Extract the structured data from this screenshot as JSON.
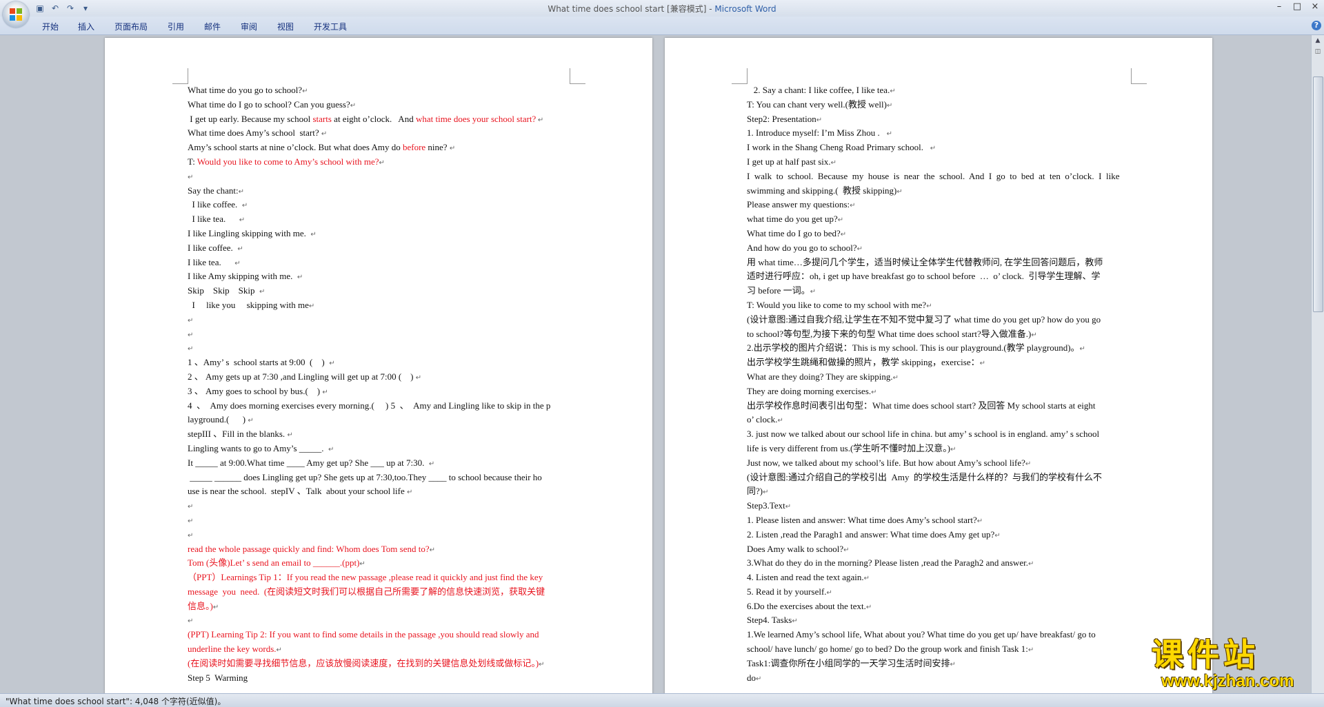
{
  "window": {
    "title_doc": "What time does school start [兼容模式] - ",
    "title_app": "Microsoft Word",
    "controls": [
      "–",
      "□",
      "×"
    ]
  },
  "qat": [
    "save-icon",
    "undo-icon",
    "redo-icon",
    "customize-icon"
  ],
  "ribbon": {
    "tabs": [
      "开始",
      "插入",
      "页面布局",
      "引用",
      "邮件",
      "审阅",
      "视图",
      "开发工具"
    ],
    "help": "?"
  },
  "left_page": {
    "lines": [
      {
        "parts": [
          {
            "t": "What time do you go to school?"
          },
          {
            "t": "↵",
            "pm": 1
          }
        ]
      },
      {
        "parts": [
          {
            "t": "What time do I go to school? Can you guess?"
          },
          {
            "t": "↵",
            "pm": 1
          }
        ]
      },
      {
        "parts": [
          {
            "t": " I get up early. Because my school "
          },
          {
            "t": "starts",
            "r": 1
          },
          {
            "t": " at eight o’clock.   And "
          },
          {
            "t": "what time does your school start?",
            "r": 1
          },
          {
            "t": " ↵",
            "pm": 1
          }
        ]
      },
      {
        "parts": [
          {
            "t": "What time does Amy’s school  start? "
          },
          {
            "t": "↵",
            "pm": 1
          }
        ]
      },
      {
        "parts": [
          {
            "t": "Amy’s school starts at nine o’clock. But what does Amy do "
          },
          {
            "t": "before",
            "r": 1
          },
          {
            "t": " nine? "
          },
          {
            "t": "↵",
            "pm": 1
          }
        ]
      },
      {
        "parts": [
          {
            "t": "T: "
          },
          {
            "t": "Would you like to come to Amy’s school with me?",
            "r": 1
          },
          {
            "t": "↵",
            "pm": 1
          }
        ]
      },
      {
        "parts": [
          {
            "t": "↵",
            "pm": 1
          }
        ]
      },
      {
        "parts": [
          {
            "t": "Say the chant:"
          },
          {
            "t": "↵",
            "pm": 1
          }
        ]
      },
      {
        "parts": [
          {
            "t": "  I like coffee.  "
          },
          {
            "t": "↵",
            "pm": 1
          }
        ]
      },
      {
        "parts": [
          {
            "t": "  I like tea.      "
          },
          {
            "t": "↵",
            "pm": 1
          }
        ]
      },
      {
        "parts": [
          {
            "t": "I like Lingling skipping with me.  "
          },
          {
            "t": "↵",
            "pm": 1
          }
        ]
      },
      {
        "parts": [
          {
            "t": "I like coffee.  "
          },
          {
            "t": "↵",
            "pm": 1
          }
        ]
      },
      {
        "parts": [
          {
            "t": "I like tea.      "
          },
          {
            "t": "↵",
            "pm": 1
          }
        ]
      },
      {
        "parts": [
          {
            "t": "I like Amy skipping with me.  "
          },
          {
            "t": "↵",
            "pm": 1
          }
        ]
      },
      {
        "parts": [
          {
            "t": "Skip    Skip    Skip  "
          },
          {
            "t": "↵",
            "pm": 1
          }
        ]
      },
      {
        "parts": [
          {
            "t": "  I     like you     skipping with me"
          },
          {
            "t": "↵",
            "pm": 1
          }
        ]
      },
      {
        "parts": [
          {
            "t": "↵",
            "pm": 1
          }
        ]
      },
      {
        "parts": [
          {
            "t": "↵",
            "pm": 1
          }
        ]
      },
      {
        "parts": [
          {
            "t": "↵",
            "pm": 1
          }
        ]
      },
      {
        "parts": [
          {
            "t": "1 、Amy’ s  school starts at 9:00  (    )  "
          },
          {
            "t": "↵",
            "pm": 1
          }
        ]
      },
      {
        "parts": [
          {
            "t": "2 、 Amy gets up at 7:30 ,and Lingling will get up at 7:00 (    ) "
          },
          {
            "t": "↵",
            "pm": 1
          }
        ]
      },
      {
        "parts": [
          {
            "t": "3 、 Amy goes to school by bus.(    ) "
          },
          {
            "t": "↵",
            "pm": 1
          }
        ]
      },
      {
        "parts": [
          {
            "t": "4  、  Amy does morning exercises every morning.(     ) 5  、  Amy and Lingling like to skip in the p"
          }
        ]
      },
      {
        "parts": [
          {
            "t": "layground.(      ) "
          },
          {
            "t": "↵",
            "pm": 1
          }
        ]
      },
      {
        "parts": [
          {
            "t": "stepIII 、Fill in the blanks. "
          },
          {
            "t": "↵",
            "pm": 1
          }
        ]
      },
      {
        "parts": [
          {
            "t": "Lingling wants to go to Amy’s _____.  "
          },
          {
            "t": "↵",
            "pm": 1
          }
        ]
      },
      {
        "parts": [
          {
            "t": "It _____ at 9:00.What time ____ Amy get up? She ___ up at 7:30.  "
          },
          {
            "t": "↵",
            "pm": 1
          }
        ]
      },
      {
        "parts": [
          {
            "t": " _____ ______ does Lingling get up? She gets up at 7:30,too.They ____ to school because their ho"
          }
        ]
      },
      {
        "parts": [
          {
            "t": "use is near the school.  stepIV 、Talk  about your school life "
          },
          {
            "t": "↵",
            "pm": 1
          }
        ]
      },
      {
        "parts": [
          {
            "t": "↵",
            "pm": 1
          }
        ]
      },
      {
        "parts": [
          {
            "t": "↵",
            "pm": 1
          }
        ]
      },
      {
        "parts": [
          {
            "t": "↵",
            "pm": 1
          }
        ]
      },
      {
        "parts": [
          {
            "t": "read the whole passage quickly and find: Whom does Tom send to?",
            "r": 1
          },
          {
            "t": "↵",
            "pm": 1
          }
        ]
      },
      {
        "parts": [
          {
            "t": "Tom (头像)Let’ s send an email to ______.(ppt)",
            "r": 1
          },
          {
            "t": "↵",
            "pm": 1
          }
        ]
      },
      {
        "parts": [
          {
            "t": "（PPT）Learnings Tip 1：If you read the new passage ,please read it quickly and just find the key",
            "r": 1
          }
        ]
      },
      {
        "parts": [
          {
            "t": "message  you  need.  (在阅读短文时我们可以根据自己所需要了解的信息快速浏览，获取关键",
            "r": 1
          }
        ]
      },
      {
        "parts": [
          {
            "t": "信息。)",
            "r": 1
          },
          {
            "t": "↵",
            "pm": 1
          }
        ]
      },
      {
        "parts": [
          {
            "t": "↵",
            "pm": 1
          }
        ]
      },
      {
        "parts": [
          {
            "t": "(PPT) Learning Tip 2: If you want to find some details in the passage ,you should read slowly and",
            "r": 1
          }
        ]
      },
      {
        "parts": [
          {
            "t": "underline the key words.",
            "r": 1
          },
          {
            "t": "↵",
            "pm": 1
          }
        ]
      },
      {
        "parts": [
          {
            "t": "(在阅读时如需要寻找细节信息，应该放慢阅读速度，在找到的关键信息处划线或做标记。)",
            "r": 1
          },
          {
            "t": "↵",
            "pm": 1
          }
        ]
      },
      {
        "parts": [
          {
            "t": "Step 5  Warming"
          }
        ]
      }
    ]
  },
  "right_page": {
    "lines": [
      {
        "parts": [
          {
            "t": "   2. Say a chant: I like coffee, I like tea."
          },
          {
            "t": "↵",
            "pm": 1
          }
        ]
      },
      {
        "parts": [
          {
            "t": "T: You can chant very well.(教授 well)"
          },
          {
            "t": "↵",
            "pm": 1
          }
        ]
      },
      {
        "parts": [
          {
            "t": "Step2: Presentation"
          },
          {
            "t": "↵",
            "pm": 1
          }
        ]
      },
      {
        "parts": [
          {
            "t": "1. Introduce myself: I’m Miss Zhou .   "
          },
          {
            "t": "↵",
            "pm": 1
          }
        ]
      },
      {
        "parts": [
          {
            "t": "I work in the Shang Cheng Road Primary school.   "
          },
          {
            "t": "↵",
            "pm": 1
          }
        ]
      },
      {
        "parts": [
          {
            "t": "I get up at half past six."
          },
          {
            "t": "↵",
            "pm": 1
          }
        ]
      },
      {
        "parts": [
          {
            "t": "I  walk  to  school.  Because  my  house  is  near  the  school.  And  I  go  to  bed  at  ten  o’clock.  I  like"
          }
        ]
      },
      {
        "parts": [
          {
            "t": "swimming and skipping.(  教授 skipping)"
          },
          {
            "t": "↵",
            "pm": 1
          }
        ]
      },
      {
        "parts": [
          {
            "t": "Please answer my questions:"
          },
          {
            "t": "↵",
            "pm": 1
          }
        ]
      },
      {
        "parts": [
          {
            "t": "what time do you get up?"
          },
          {
            "t": "↵",
            "pm": 1
          }
        ]
      },
      {
        "parts": [
          {
            "t": "What time do I go to bed?"
          },
          {
            "t": "↵",
            "pm": 1
          }
        ]
      },
      {
        "parts": [
          {
            "t": "And how do you go to school?"
          },
          {
            "t": "↵",
            "pm": 1
          }
        ]
      },
      {
        "parts": [
          {
            "t": "用 what time…多提问几个学生，适当时候让全体学生代替教师问, 在学生回答问题后，教师"
          }
        ]
      },
      {
        "parts": [
          {
            "t": "适时进行呼应：oh, i get up have breakfast go to school before  …  o’ clock.  引导学生理解、学"
          }
        ]
      },
      {
        "parts": [
          {
            "t": "习 before 一词。"
          },
          {
            "t": "↵",
            "pm": 1
          }
        ]
      },
      {
        "parts": [
          {
            "t": "T: Would you like to come to my school with me?"
          },
          {
            "t": "↵",
            "pm": 1
          }
        ]
      },
      {
        "parts": [
          {
            "t": "(设计意图:通过自我介绍,让学生在不知不觉中复习了 what time do you get up? how do you go"
          }
        ]
      },
      {
        "parts": [
          {
            "t": "to school?等句型,为接下来的句型 What time does school start?导入做准备.)"
          },
          {
            "t": "↵",
            "pm": 1
          }
        ]
      },
      {
        "parts": [
          {
            "t": "2.出示学校的图片介绍说：This is my school. This is our playground.(教学 playground)。"
          },
          {
            "t": "↵",
            "pm": 1
          }
        ]
      },
      {
        "parts": [
          {
            "t": "出示学校学生跳绳和做操的照片，教学 skipping，exercise："
          },
          {
            "t": "↵",
            "pm": 1
          }
        ]
      },
      {
        "parts": [
          {
            "t": "What are they doing? They are skipping."
          },
          {
            "t": "↵",
            "pm": 1
          }
        ]
      },
      {
        "parts": [
          {
            "t": "They are doing morning exercises."
          },
          {
            "t": "↵",
            "pm": 1
          }
        ]
      },
      {
        "parts": [
          {
            "t": "出示学校作息时间表引出句型：What time does school start? 及回答 My school starts at eight"
          }
        ]
      },
      {
        "parts": [
          {
            "t": "o’ clock."
          },
          {
            "t": "↵",
            "pm": 1
          }
        ]
      },
      {
        "parts": [
          {
            "t": "3. just now we talked about our school life in china. but amy’ s school is in england. amy’ s school"
          }
        ]
      },
      {
        "parts": [
          {
            "t": "life is very different from us.(学生听不懂时加上汉意。)"
          },
          {
            "t": "↵",
            "pm": 1
          }
        ]
      },
      {
        "parts": [
          {
            "t": "Just now, we talked about my school’s life. But how about Amy’s school life?"
          },
          {
            "t": "↵",
            "pm": 1
          }
        ]
      },
      {
        "parts": [
          {
            "t": "(设计意图:通过介绍自己的学校引出  Amy  的学校生活是什么样的？与我们的学校有什么不"
          }
        ]
      },
      {
        "parts": [
          {
            "t": "同?)"
          },
          {
            "t": "↵",
            "pm": 1
          }
        ]
      },
      {
        "parts": [
          {
            "t": "Step3.Text"
          },
          {
            "t": "↵",
            "pm": 1
          }
        ]
      },
      {
        "parts": [
          {
            "t": "1. Please listen and answer: What time does Amy’s school start?"
          },
          {
            "t": "↵",
            "pm": 1
          }
        ]
      },
      {
        "parts": [
          {
            "t": "2. Listen ,read the Paragh1 and answer: What time does Amy get up?"
          },
          {
            "t": "↵",
            "pm": 1
          }
        ]
      },
      {
        "parts": [
          {
            "t": "Does Amy walk to school?"
          },
          {
            "t": "↵",
            "pm": 1
          }
        ]
      },
      {
        "parts": [
          {
            "t": "3.What do they do in the morning? Please listen ,read the Paragh2 and answer."
          },
          {
            "t": "↵",
            "pm": 1
          }
        ]
      },
      {
        "parts": [
          {
            "t": "4. Listen and read the text again."
          },
          {
            "t": "↵",
            "pm": 1
          }
        ]
      },
      {
        "parts": [
          {
            "t": "5. Read it by yourself."
          },
          {
            "t": "↵",
            "pm": 1
          }
        ]
      },
      {
        "parts": [
          {
            "t": "6.Do the exercises about the text."
          },
          {
            "t": "↵",
            "pm": 1
          }
        ]
      },
      {
        "parts": [
          {
            "t": "Step4. Tasks"
          },
          {
            "t": "↵",
            "pm": 1
          }
        ]
      },
      {
        "parts": [
          {
            "t": "1.We learned Amy’s school life, What about you? What time do you get up/ have breakfast/ go to"
          }
        ]
      },
      {
        "parts": [
          {
            "t": "school/ have lunch/ go home/ go to bed? Do the group work and finish Task 1:"
          },
          {
            "t": "↵",
            "pm": 1
          }
        ]
      },
      {
        "parts": [
          {
            "t": "Task1:调查你所在小组同学的一天学习生活时间安排"
          },
          {
            "t": "↵",
            "pm": 1
          }
        ]
      },
      {
        "parts": [
          {
            "t": "do"
          },
          {
            "t": "↵",
            "pm": 1
          }
        ]
      }
    ]
  },
  "statusbar": {
    "text": "\"What time does school start\": 4,048 个字符(近似值)。"
  },
  "watermark": {
    "cn": "课件站",
    "url": "www.kjzhan.com"
  },
  "colors": {
    "red_text": "#e8141f",
    "ribbon_bg": "#cfdbec",
    "watermark": "#ffd800"
  }
}
